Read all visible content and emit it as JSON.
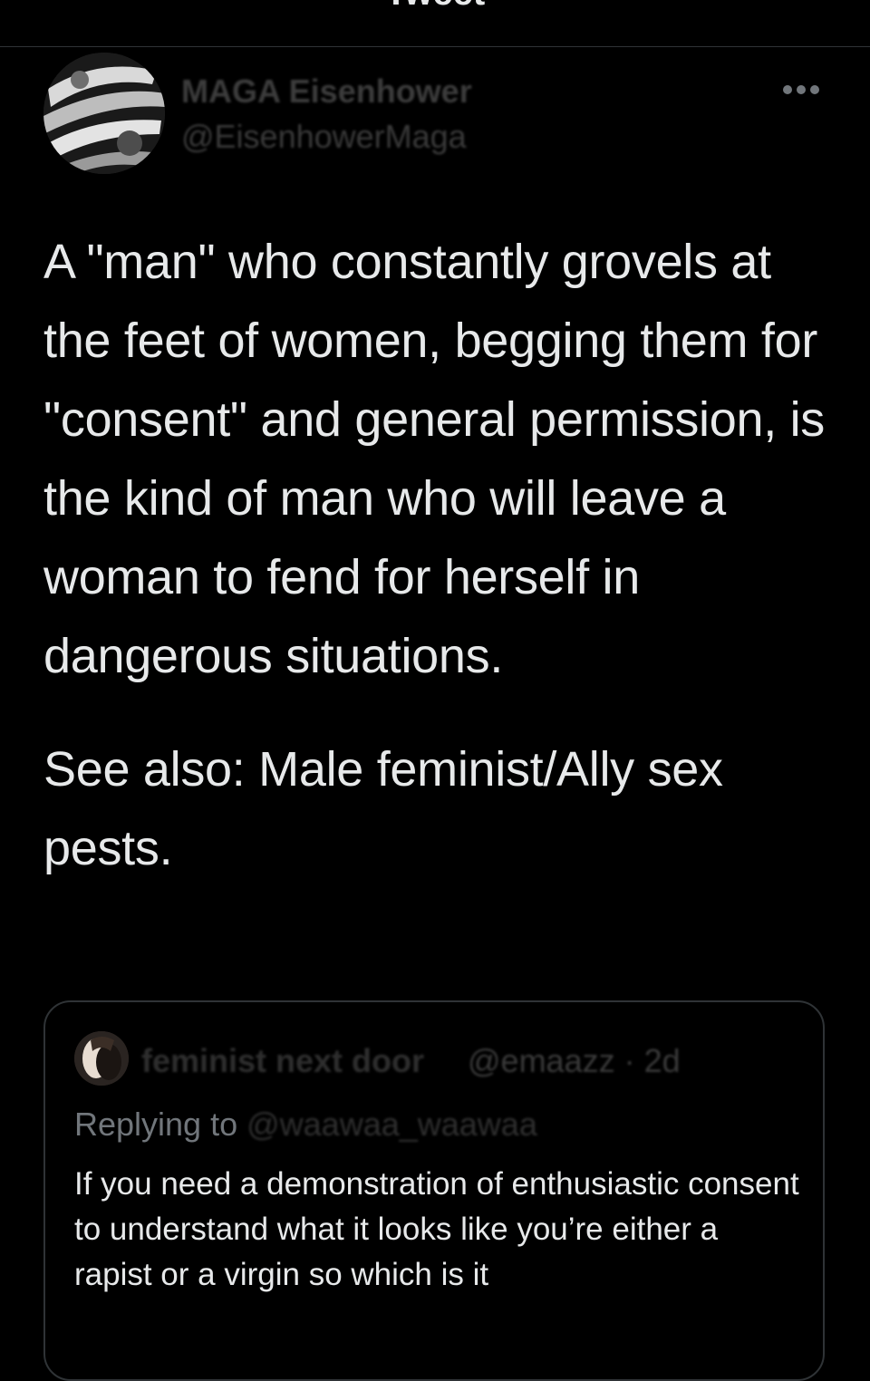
{
  "header": {
    "title": "Tweet",
    "back_icon": "chevron-left-icon",
    "accent_color": "#1d9bf0"
  },
  "author": {
    "display_name": "MAGA Eisenhower",
    "handle": "@EisenhowerMaga",
    "avatar_icon": "avatar-image",
    "more_icon": "more-horizontal-icon"
  },
  "tweet": {
    "paragraphs": [
      "A \"man\" who constantly grovels at the feet of women, begging them for \"consent\" and general permission, is the kind of man who will leave a woman to fend for herself in dangerous situations.",
      "See also: Male feminist/Ally sex pests."
    ]
  },
  "quoted_tweet": {
    "author_name": "feminist next door",
    "meta": "@emaazz · 2d",
    "replying_prefix": "Replying to ",
    "replying_handle": "@waawaa_waawaa",
    "text": "If you need a demonstration of enthusiastic consent to understand what it looks like you’re either a rapist or a virgin so which is it"
  },
  "colors": {
    "background": "#000000",
    "text_primary": "#e7e9ea",
    "text_secondary": "#71767b",
    "border": "#2f3336"
  }
}
